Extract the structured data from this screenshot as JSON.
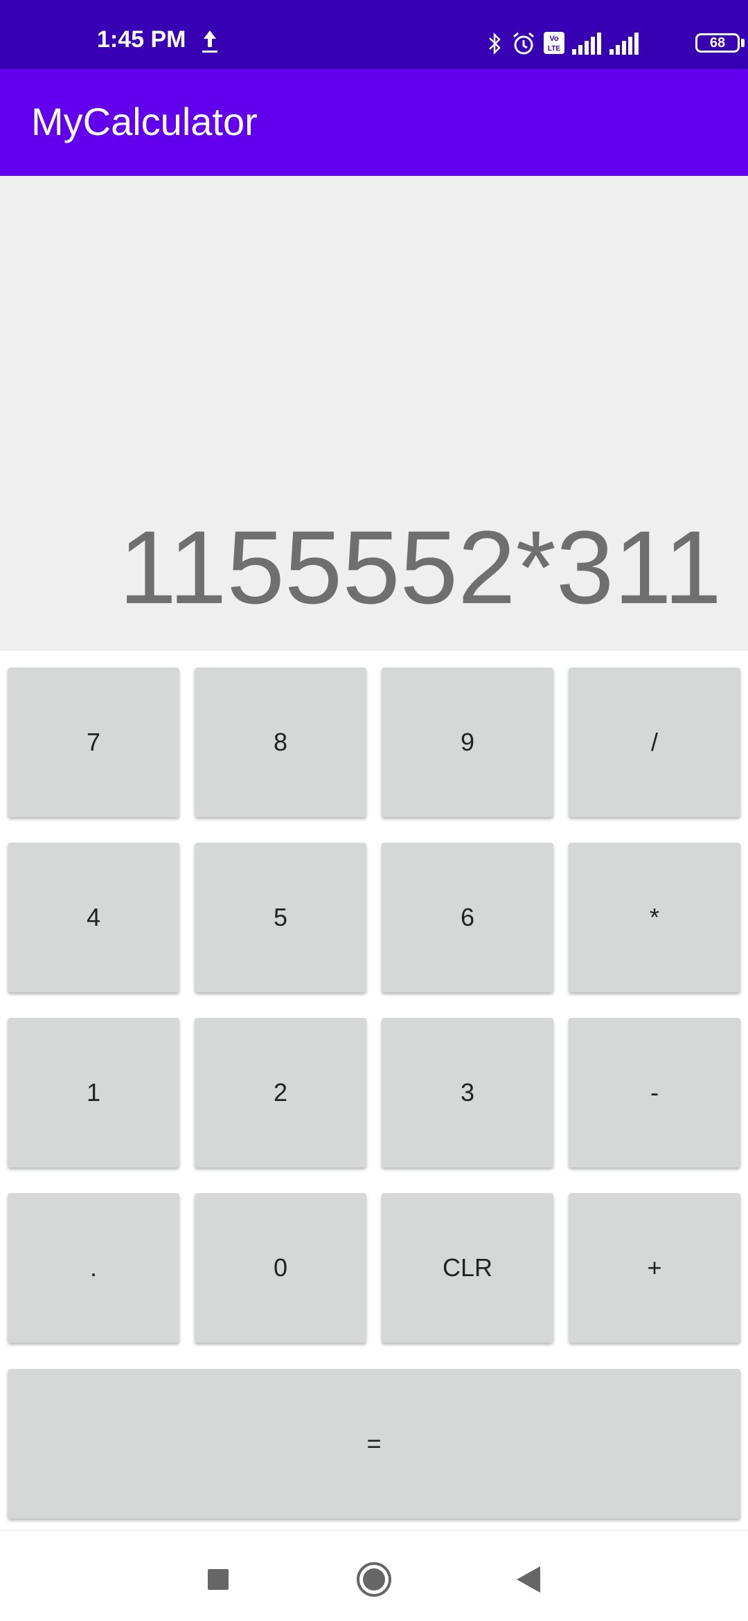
{
  "status_bar": {
    "time": "1:45 PM",
    "battery": "68",
    "icons": [
      "upload-icon",
      "bluetooth-icon",
      "alarm-icon",
      "volte-icon",
      "signal-icon",
      "signal-icon",
      "battery-icon"
    ]
  },
  "app_bar": {
    "title": "MyCalculator"
  },
  "display": {
    "expression": "1155552*311"
  },
  "keypad": {
    "rows": [
      [
        "7",
        "8",
        "9",
        "/"
      ],
      [
        "4",
        "5",
        "6",
        "*"
      ],
      [
        "1",
        "2",
        "3",
        "-"
      ],
      [
        ".",
        "0",
        "CLR",
        "+"
      ]
    ],
    "equals": "="
  },
  "nav_bar": {
    "icons": [
      "recent-apps-icon",
      "home-icon",
      "back-icon"
    ]
  },
  "colors": {
    "status_bar": "#3700b3",
    "app_bar": "#6200ee",
    "display_bg": "#efefef",
    "display_text": "#6f6f6f",
    "key_bg": "#d6d7d7"
  }
}
